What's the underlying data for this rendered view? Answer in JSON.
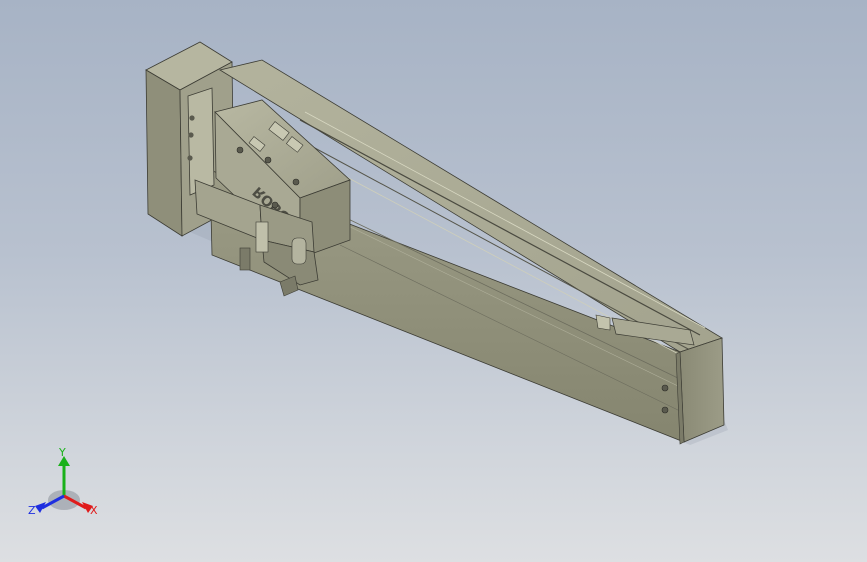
{
  "viewport": {
    "background_top": "#a7b3c5",
    "background_bottom": "#dddfe2"
  },
  "model": {
    "carriage_engraving": "ROBOT",
    "body_color": "#9a9a84",
    "body_shadow_color": "#7d7d6a"
  },
  "triad": {
    "x_label": "X",
    "y_label": "Y",
    "z_label": "Z",
    "x_color": "#e01b1b",
    "y_color": "#1ab11a",
    "z_color": "#1e2fe0"
  }
}
